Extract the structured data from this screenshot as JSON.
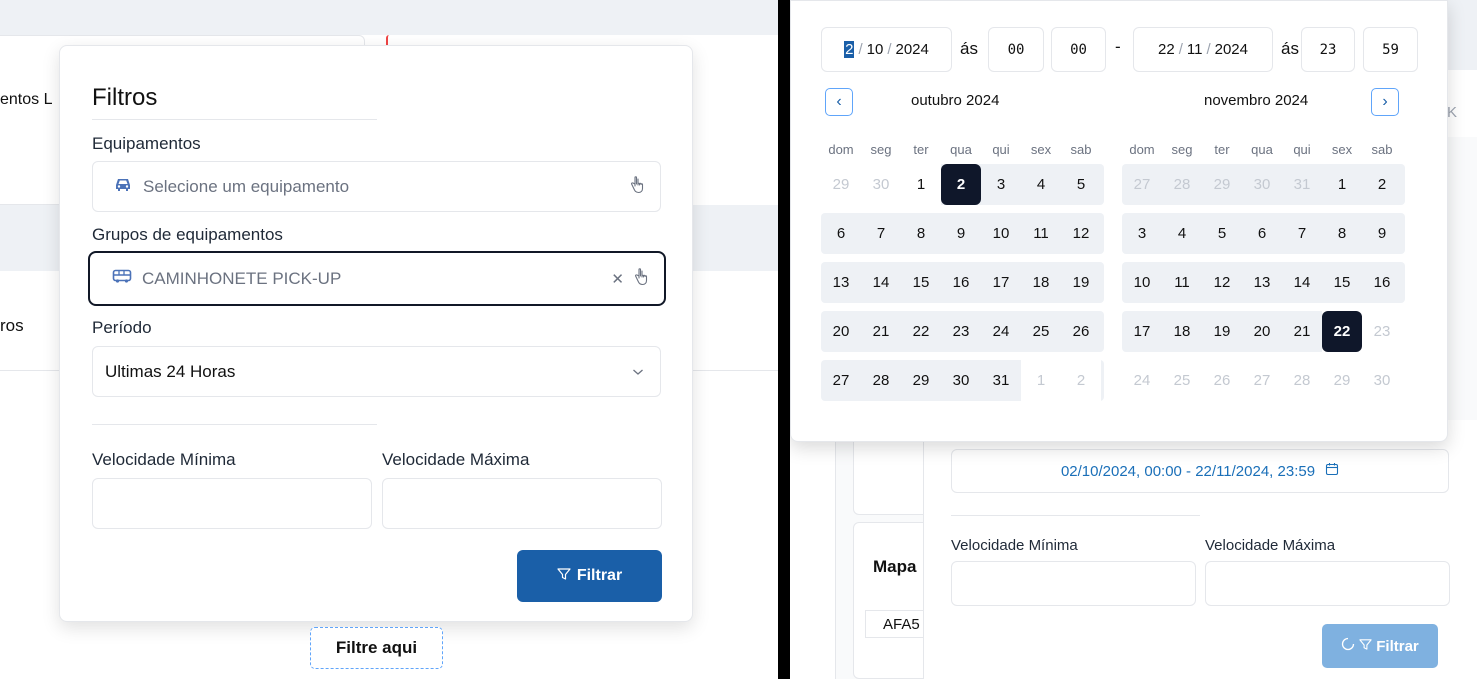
{
  "left": {
    "background_text_1": "entos L",
    "background_text_2": "ros",
    "filters": {
      "title": "Filtros",
      "equipamentos_label": "Equipamentos",
      "equipamentos_placeholder": "Selecione um equipamento",
      "grupos_label": "Grupos de equipamentos",
      "grupos_value": "CAMINHONETE PICK-UP",
      "periodo_label": "Período",
      "periodo_value": "Ultimas 24 Horas",
      "vel_min_label": "Velocidade Mínima",
      "vel_max_label": "Velocidade Máxima",
      "filtrar_button": "Filtrar"
    },
    "filtre_aqui": "Filtre aqui"
  },
  "right": {
    "date_start": {
      "day": "2",
      "month": "10",
      "year": "2024"
    },
    "as_label": "ás",
    "time_start": {
      "hour": "00",
      "minute": "00"
    },
    "range_dash": "-",
    "date_end": {
      "day": "22",
      "month": "11",
      "year": "2024"
    },
    "time_end": {
      "hour": "23",
      "minute": "59"
    },
    "month_left": "outubro 2024",
    "month_right": "novembro 2024",
    "weekdays": [
      "dom",
      "seg",
      "ter",
      "qua",
      "qui",
      "sex",
      "sab"
    ],
    "date_range_display": "02/10/2024, 00:00 - 22/11/2024, 23:59",
    "vel_min_label": "Velocidade Mínima",
    "vel_max_label": "Velocidade Máxima",
    "filtrar_button": "Filtrar",
    "mapa_label": "Mapa",
    "afa_label": "AFA5",
    "side_k": "K"
  },
  "icons": {
    "car": "car-icon",
    "bus": "bus-icon",
    "pointer": "hand-pointer-icon",
    "close": "close-icon",
    "chevron": "chevron-down-icon",
    "funnel": "filter-icon",
    "calendar": "calendar-icon",
    "spinner": "loading-icon",
    "prev": "chevron-left-icon",
    "next": "chevron-right-icon"
  },
  "colors": {
    "primary": "#1a5fa8",
    "primary_disabled": "#7fb1e0",
    "selected_day": "#0f172a",
    "range_bg": "#eef1f5",
    "link_text": "#1a6fb8"
  }
}
